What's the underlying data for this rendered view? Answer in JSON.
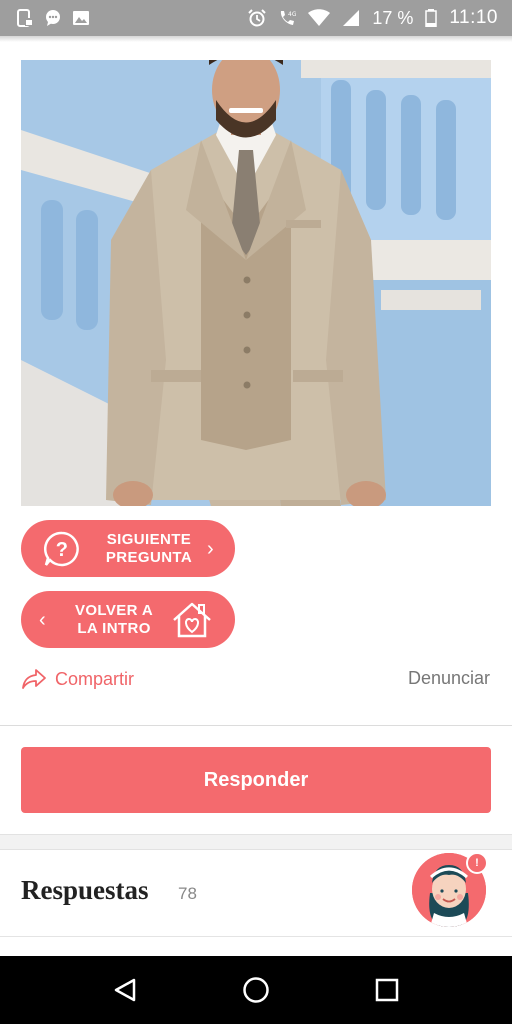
{
  "status_bar": {
    "battery_percent": "17 %",
    "time": "11:10",
    "icons_left": [
      "screenshot-icon",
      "chat-bubble-icon",
      "image-icon"
    ],
    "icons_right": [
      "alarm-icon",
      "wifi-calling-icon",
      "wifi-icon",
      "signal-icon",
      "battery-icon"
    ]
  },
  "post": {
    "image_description_icon": "suit-photo"
  },
  "buttons": {
    "next_question": "SIGUIENTE\nPREGUNTA",
    "back_to_intro": "VOLVER A\nLA INTRO",
    "share": "Compartir",
    "report": "Denunciar",
    "respond": "Responder"
  },
  "answers": {
    "title": "Respuestas",
    "count": "78",
    "notification_badge": "!"
  },
  "colors": {
    "accent": "#f46a6e",
    "status_bar": "#9e9e9e",
    "nav_bar": "#000000"
  }
}
